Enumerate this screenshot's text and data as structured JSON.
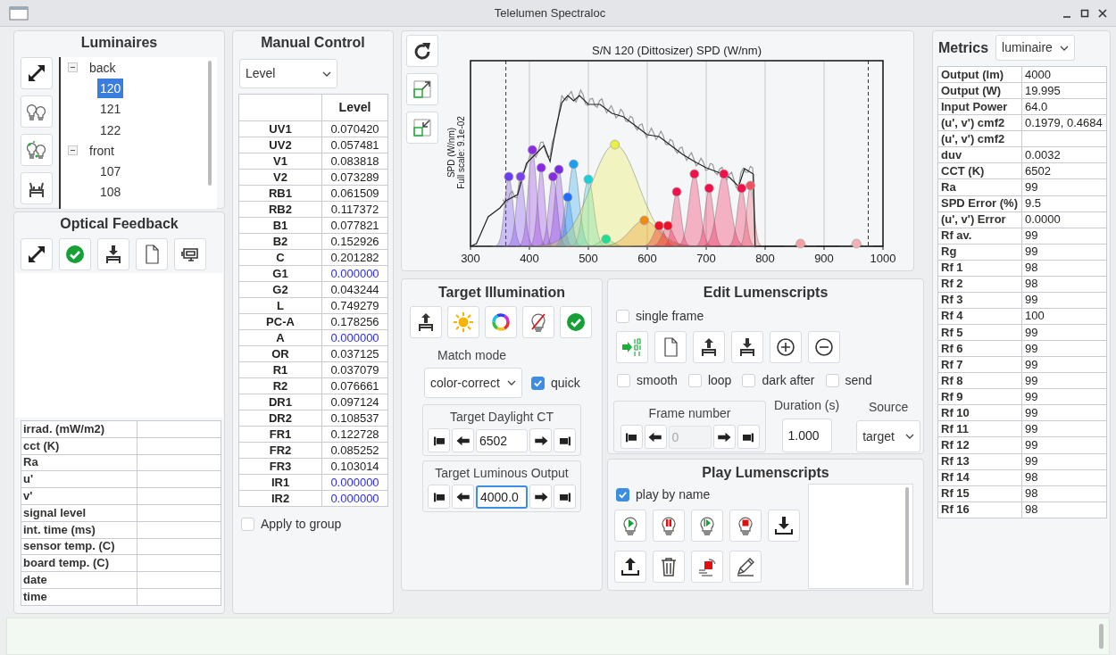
{
  "window": {
    "title": "Telelumen Spectraloc"
  },
  "luminaires": {
    "title": "Luminaires",
    "tree": [
      {
        "label": "back",
        "expanded": true,
        "selected": false,
        "children": [
          {
            "label": "120",
            "selected": true
          },
          {
            "label": "121",
            "selected": false
          },
          {
            "label": "122",
            "selected": false
          }
        ]
      },
      {
        "label": "front",
        "expanded": true,
        "selected": false,
        "children": [
          {
            "label": "107",
            "selected": false
          },
          {
            "label": "108",
            "selected": false
          }
        ]
      }
    ]
  },
  "optical_feedback": {
    "title": "Optical Feedback",
    "readings": [
      "irrad. (mW/m2)",
      "cct (K)",
      "Ra",
      "u'",
      "v'",
      "signal level",
      "int. time (ms)",
      "sensor temp. (C)",
      "board temp. (C)",
      "date",
      "time"
    ]
  },
  "manual_control": {
    "title": "Manual Control",
    "mode": "Level",
    "column": "Level",
    "channels": [
      {
        "name": "UV1",
        "value": "0.070420",
        "color": "#222222"
      },
      {
        "name": "UV2",
        "value": "0.057481",
        "color": "#222222"
      },
      {
        "name": "V1",
        "value": "0.083818",
        "color": "#222222"
      },
      {
        "name": "V2",
        "value": "0.073289",
        "color": "#222222"
      },
      {
        "name": "RB1",
        "value": "0.061509",
        "color": "#222222"
      },
      {
        "name": "RB2",
        "value": "0.117372",
        "color": "#222222"
      },
      {
        "name": "B1",
        "value": "0.077821",
        "color": "#222222"
      },
      {
        "name": "B2",
        "value": "0.152926",
        "color": "#222222"
      },
      {
        "name": "C",
        "value": "0.201282",
        "color": "#222222"
      },
      {
        "name": "G1",
        "value": "0.000000",
        "color": "#2b2bf0"
      },
      {
        "name": "G2",
        "value": "0.043244",
        "color": "#222222"
      },
      {
        "name": "L",
        "value": "0.749279",
        "color": "#222222"
      },
      {
        "name": "PC-A",
        "value": "0.178256",
        "color": "#222222"
      },
      {
        "name": "A",
        "value": "0.000000",
        "color": "#2b2bf0"
      },
      {
        "name": "OR",
        "value": "0.037125",
        "color": "#222222"
      },
      {
        "name": "R1",
        "value": "0.037079",
        "color": "#222222"
      },
      {
        "name": "R2",
        "value": "0.076661",
        "color": "#222222"
      },
      {
        "name": "DR1",
        "value": "0.097124",
        "color": "#222222"
      },
      {
        "name": "DR2",
        "value": "0.108537",
        "color": "#222222"
      },
      {
        "name": "FR1",
        "value": "0.122728",
        "color": "#222222"
      },
      {
        "name": "FR2",
        "value": "0.085252",
        "color": "#222222"
      },
      {
        "name": "FR3",
        "value": "0.103014",
        "color": "#222222"
      },
      {
        "name": "IR1",
        "value": "0.000000",
        "color": "#2b2bf0"
      },
      {
        "name": "IR2",
        "value": "0.000000",
        "color": "#2b2bf0"
      }
    ],
    "apply_to_group": {
      "label": "Apply to group",
      "checked": false
    }
  },
  "plot": {
    "title": "S/N 120 (Dittosizer) SPD (W/nm)",
    "ylabel": [
      "SPD (W/nm)",
      "Full scale: 9.1e-02"
    ],
    "x_tick_labels": [
      "300",
      "400",
      "500",
      "600",
      "700",
      "800",
      "900",
      "1000"
    ]
  },
  "target_illumination": {
    "title": "Target Illumination",
    "match_mode_label": "Match mode",
    "match_mode": "color-correct",
    "quick": {
      "label": "quick",
      "checked": true
    },
    "daylight_ct": {
      "label": "Target Daylight CT",
      "value": "6502",
      "focused": false
    },
    "luminous_output": {
      "label": "Target Luminous Output",
      "value": "4000.0",
      "focused": true
    }
  },
  "edit_lumenscripts": {
    "title": "Edit Lumenscripts",
    "single_frame": {
      "label": "single frame",
      "checked": false
    },
    "options": [
      {
        "label": "smooth",
        "checked": false
      },
      {
        "label": "loop",
        "checked": false
      },
      {
        "label": "dark after",
        "checked": false
      },
      {
        "label": "send",
        "checked": false
      }
    ],
    "frame_number": {
      "label": "Frame number",
      "value": "0",
      "disabled": true
    },
    "duration": {
      "label": "Duration (s)",
      "value": "1.000"
    },
    "source": {
      "label": "Source",
      "value": "target"
    }
  },
  "play_lumenscripts": {
    "title": "Play Lumenscripts",
    "play_by_name": {
      "label": "play by name",
      "checked": true
    }
  },
  "metrics": {
    "title": "Metrics",
    "scope": "luminaire",
    "rows": [
      {
        "label": "Output (lm)",
        "value": "4000"
      },
      {
        "label": "Output (W)",
        "value": "19.995"
      },
      {
        "label": "Input Power",
        "value": "64.0"
      },
      {
        "label": "(u', v') cmf2",
        "value": "0.1979, 0.4684"
      },
      {
        "label": "(u', v') cmf2"
      },
      {
        "label": "duv",
        "value": "0.0032"
      },
      {
        "label": "CCT (K)",
        "value": "6502"
      },
      {
        "label": "Ra",
        "value": "99"
      },
      {
        "label": "SPD Error (%)",
        "value": "9.5"
      },
      {
        "label": "(u', v') Error",
        "value": "0.0000"
      },
      {
        "label": "Rf av.",
        "value": "99"
      },
      {
        "label": "Rg",
        "value": "99"
      },
      {
        "label": "Rf 1",
        "value": "98"
      },
      {
        "label": "Rf 2",
        "value": "98"
      },
      {
        "label": "Rf 3",
        "value": "99"
      },
      {
        "label": "Rf 4",
        "value": "100"
      },
      {
        "label": "Rf 5",
        "value": "99"
      },
      {
        "label": "Rf 6",
        "value": "99"
      },
      {
        "label": "Rf 7",
        "value": "99"
      },
      {
        "label": "Rf 8",
        "value": "99"
      },
      {
        "label": "Rf 9",
        "value": "99"
      },
      {
        "label": "Rf 10",
        "value": "99"
      },
      {
        "label": "Rf 11",
        "value": "99"
      },
      {
        "label": "Rf 12",
        "value": "99"
      },
      {
        "label": "Rf 13",
        "value": "99"
      },
      {
        "label": "Rf 14",
        "value": "98"
      },
      {
        "label": "Rf 15",
        "value": "98"
      },
      {
        "label": "Rf 16",
        "value": "98"
      }
    ]
  }
}
